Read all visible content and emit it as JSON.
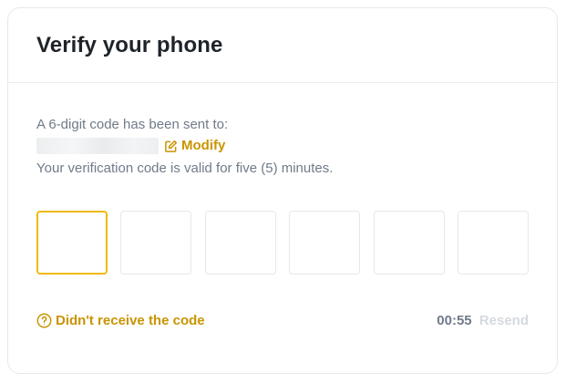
{
  "header": {
    "title": "Verify your phone"
  },
  "info": {
    "sent_to_label": "A 6-digit code has been sent to:",
    "phone_masked": "",
    "modify_label": "Modify",
    "validity_text": "Your verification code is valid for five (5) minutes."
  },
  "code_inputs": {
    "digits": [
      "",
      "",
      "",
      "",
      "",
      ""
    ],
    "active_index": 0
  },
  "footer": {
    "help_label": "Didn't receive the code",
    "timer": "00:55",
    "resend_label": "Resend"
  },
  "colors": {
    "accent": "#c99400",
    "focus_border": "#f0b90b",
    "muted_text": "#707a8a",
    "disabled_text": "#d5d9de",
    "title_text": "#1e2329"
  },
  "icons": {
    "modify": "edit-icon",
    "help": "question-circle-icon"
  }
}
